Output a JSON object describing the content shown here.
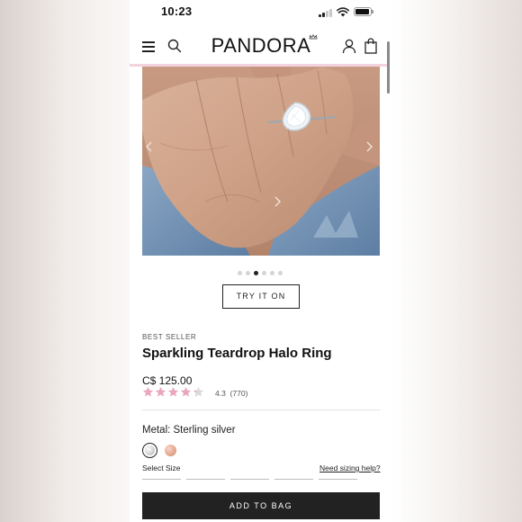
{
  "status_bar": {
    "time": "10:23"
  },
  "header": {
    "logo": "PANDORA"
  },
  "carousel": {
    "dot_count": 6,
    "active_index": 2
  },
  "product": {
    "try_on_label": "TRY IT ON",
    "badge": "BEST SELLER",
    "name": "Sparkling Teardrop Halo Ring",
    "price": "C$ 125.00",
    "rating_value": 4.3,
    "rating_text": "4.3",
    "review_count": "(770)",
    "metal_label": "Metal: Sterling silver",
    "select_size_label": "Select Size",
    "sizing_help_label": "Need sizing help?",
    "add_to_bag_label": "ADD TO BAG"
  },
  "colors": {
    "star_filled": "#eaa6bd",
    "star_empty": "#d9d9d9",
    "accent_bar": "#f3d3de",
    "button_dark": "#222222"
  },
  "icons": [
    "menu-icon",
    "search-icon",
    "account-icon",
    "bag-icon",
    "signal-icon",
    "wifi-icon",
    "battery-icon",
    "chevron-left-icon",
    "chevron-right-icon"
  ]
}
